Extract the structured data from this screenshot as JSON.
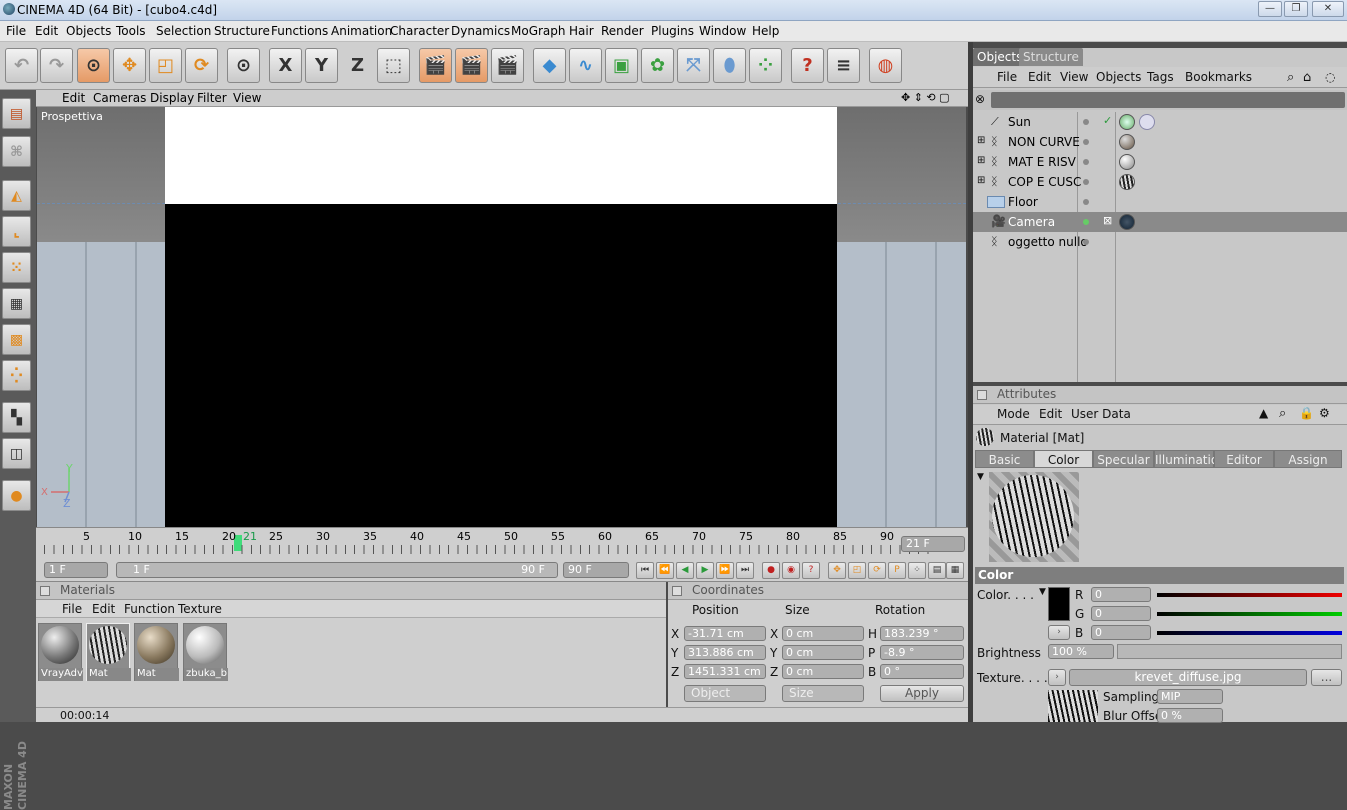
{
  "window": {
    "title": "CINEMA 4D (64 Bit) - [cubo4.c4d]",
    "controls": [
      "—",
      "❐",
      "✕"
    ]
  },
  "menubar": [
    "File",
    "Edit",
    "Objects",
    "Tools",
    "Selection",
    "Structure",
    "Functions",
    "Animation",
    "Character",
    "Dynamics",
    "MoGraph",
    "Hair",
    "Render",
    "Plugins",
    "Window",
    "Help"
  ],
  "toolbar": {
    "axis_x": "X",
    "axis_y": "Y",
    "axis_z": "Z"
  },
  "viewport": {
    "menu": [
      "Edit",
      "Cameras",
      "Display",
      "Filter",
      "View"
    ],
    "label": "Prospettiva",
    "axis_labels": {
      "y": "Y",
      "x": "X",
      "z": "Z"
    }
  },
  "timeline": {
    "ticks": [
      "5",
      "10",
      "15",
      "20",
      "21",
      "25",
      "30",
      "35",
      "40",
      "45",
      "50",
      "55",
      "60",
      "65",
      "70",
      "75",
      "80",
      "85",
      "90"
    ],
    "current_frame": "21 F",
    "start_field": "1 F",
    "range_start": "1 F",
    "range_end": "90 F",
    "end_field": "90 F"
  },
  "materials": {
    "header": "Materials",
    "menu": [
      "File",
      "Edit",
      "Function",
      "Texture"
    ],
    "items": [
      {
        "label": "VrayAdv"
      },
      {
        "label": "Mat"
      },
      {
        "label": "Mat"
      },
      {
        "label": "zbuka_b"
      }
    ]
  },
  "coordinates": {
    "header": "Coordinates",
    "col_position": "Position",
    "col_size": "Size",
    "col_rotation": "Rotation",
    "rows": [
      {
        "axis": "X",
        "pos": "-31.71 cm",
        "size_axis": "X",
        "size": "0 cm",
        "rot_axis": "H",
        "rot": "183.239 °"
      },
      {
        "axis": "Y",
        "pos": "313.886 cm",
        "size_axis": "Y",
        "size": "0 cm",
        "rot_axis": "P",
        "rot": "-8.9 °"
      },
      {
        "axis": "Z",
        "pos": "1451.331 cm",
        "size_axis": "Z",
        "size": "0 cm",
        "rot_axis": "B",
        "rot": "0 °"
      }
    ],
    "mode_object": "Object",
    "mode_size": "Size",
    "apply": "Apply"
  },
  "status": {
    "time": "00:00:14"
  },
  "objects_panel": {
    "tabs": [
      "Objects",
      "Structure"
    ],
    "menu": [
      "File",
      "Edit",
      "View",
      "Objects",
      "Tags",
      "Bookmarks"
    ],
    "items": [
      {
        "name": "Sun"
      },
      {
        "name": "NON CURVE"
      },
      {
        "name": "MAT E RISV"
      },
      {
        "name": "COP E CUSC"
      },
      {
        "name": "Floor"
      },
      {
        "name": "Camera"
      },
      {
        "name": "oggetto nullo"
      }
    ]
  },
  "attributes": {
    "header": "Attributes",
    "menu": [
      "Mode",
      "Edit",
      "User Data"
    ],
    "material_name": "Material [Mat]",
    "tabs": [
      "Basic",
      "Color",
      "Specular",
      "Illumination",
      "Editor",
      "Assign"
    ],
    "active_tab": "Color",
    "section": "Color",
    "color_label": "Color. . . .",
    "r_label": "R",
    "g_label": "G",
    "b_label": "B",
    "r": "0",
    "g": "0",
    "b": "0",
    "brightness_label": "Brightness",
    "brightness": "100 %",
    "texture_label": "Texture. . . .",
    "texture_file": "krevet_diffuse.jpg",
    "texture_more": "...",
    "sampling_label": "Sampling",
    "sampling": "MIP",
    "blur_label": "Blur Offset",
    "blur": "0 %"
  },
  "colors": {
    "timeline_cursor": "#3fdc7a",
    "active_tool": "#e59a66"
  }
}
